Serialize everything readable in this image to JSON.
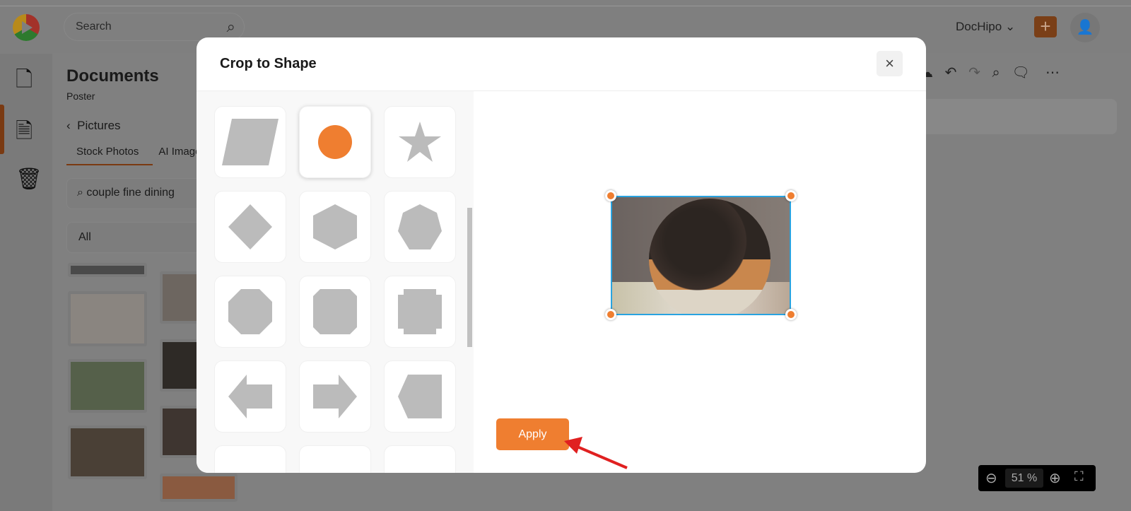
{
  "header": {
    "search_placeholder": "Search",
    "brand": "DocHipo",
    "brand_chevron": "⌄",
    "add_label": "+"
  },
  "sidebar": {
    "items": [
      {
        "icon": "document-icon"
      },
      {
        "icon": "file-text-icon",
        "active": true
      },
      {
        "icon": "trash-icon"
      }
    ]
  },
  "panel": {
    "title": "Documents",
    "subtitle": "Poster",
    "section": "Pictures",
    "tabs": [
      "Stock Photos",
      "AI Images"
    ],
    "search_value": "couple fine dining",
    "filter": "All"
  },
  "modal": {
    "title": "Crop to Shape",
    "close": "×",
    "apply_label": "Apply",
    "shapes": [
      "parallelogram",
      "circle",
      "star",
      "diamond",
      "hexagon",
      "heptagon",
      "octagon",
      "rounded-octagon",
      "cross-square",
      "arrow-left",
      "arrow-right",
      "pentagon-left"
    ],
    "selected_shape": "circle"
  },
  "zoom": {
    "value": "51",
    "unit": "%"
  },
  "colors": {
    "accent": "#ef7e30",
    "selection": "#29a3e0",
    "arrow": "#e02020"
  }
}
